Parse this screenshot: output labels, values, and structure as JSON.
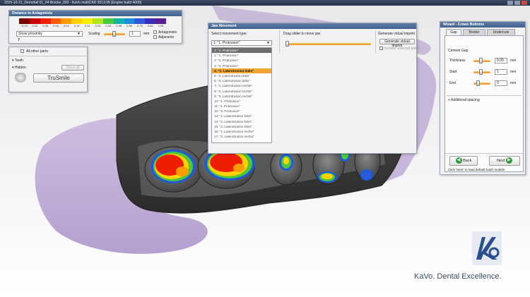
{
  "window": {
    "title": "2015-10-21_Demofall 01_04 Brücke_003 - KaVo multiCAD 2013.05 [Engine build 4009]"
  },
  "proximity_panel": {
    "title": "Distance to Antagonists",
    "scale_ticks": [
      "-0.13",
      "0.10",
      "0.06",
      "0.04",
      "0.04",
      "0.14",
      "0.14",
      "0.23",
      "0.34",
      "0.45",
      "0.56",
      "0.75",
      "0.84",
      "1.04"
    ],
    "scale_colors": [
      "#7a0000",
      "#c80000",
      "#f01e00",
      "#ff5a00",
      "#ff9b00",
      "#ffd200",
      "#f0f000",
      "#b4e61e",
      "#4bc83c",
      "#14b4aa",
      "#1e8cdc",
      "#2d5adc",
      "#3c2db4",
      "#5a1e96"
    ],
    "mode_select": "Show proximity",
    "scaling_label": "Scaling",
    "scaling_value": "1",
    "scaling_unit": "mm",
    "antagonists_label": "Antagonists",
    "adjacents_label": "Adjacents",
    "help": "?"
  },
  "tree_panel": {
    "item_all_other_parts": "All other parts",
    "section_teeth": "Teeth",
    "section_hidden": "Hidden",
    "show_all_button": "Show all",
    "trusmile_button": "TruSmile"
  },
  "jaw_dialog": {
    "title": "Jaw Movement",
    "movement_type_label": "Select movement type:",
    "movement_selected": "1: \"1. Protrusion\"",
    "slider_label": "Drag slider to move jaw",
    "virtual_imprint_label": "Generate virtual imprint",
    "virtual_imprint_button": "Generate virtual imprint",
    "include_paths_label": "Include selected paths",
    "movements": [
      "1: \"1. Protrusion\"",
      "2: \"2. Protrusion\"",
      "3: \"3. Protrusion\"",
      "4: \"1. Laterotrusion links\"",
      "5: \"2. Laterotrusion links\"",
      "6: \"3. Laterotrusion links\"",
      "7: \"1. Laterotrusion rechts\"",
      "8: \"2. Laterotrusion rechts\"",
      "9: \"3. Laterotrusion rechts\"",
      "10: \"1. Protrusion\"",
      "11: \"2. Protrusion\"",
      "12: \"3. Protrusion\"",
      "13: \"1. Laterotrusion links\"",
      "14: \"2. Laterotrusion links\"",
      "15: \"3. Laterotrusion links\"",
      "16: \"1. Laterotrusion rechts\"",
      "17: \"2. Laterotrusion rechts\""
    ]
  },
  "wizard_panel": {
    "title": "Wizard - Crown Bottoms",
    "tabs": [
      "Gap",
      "Border",
      "Undercuts"
    ],
    "section_cement_gap": "Cement Gap",
    "thickness_label": "Thickness",
    "thickness_value": "0.00",
    "start_label": "Start",
    "start_value": "1",
    "end_label": "End",
    "end_value": "0",
    "unit": "mm",
    "additional_spacing": "Additional spacing",
    "back_button": "Back",
    "next_button": "Next",
    "hint": "Click 'Next' to load default tooth models"
  },
  "branding": {
    "tagline": "KaVo. Dental Excellence."
  }
}
